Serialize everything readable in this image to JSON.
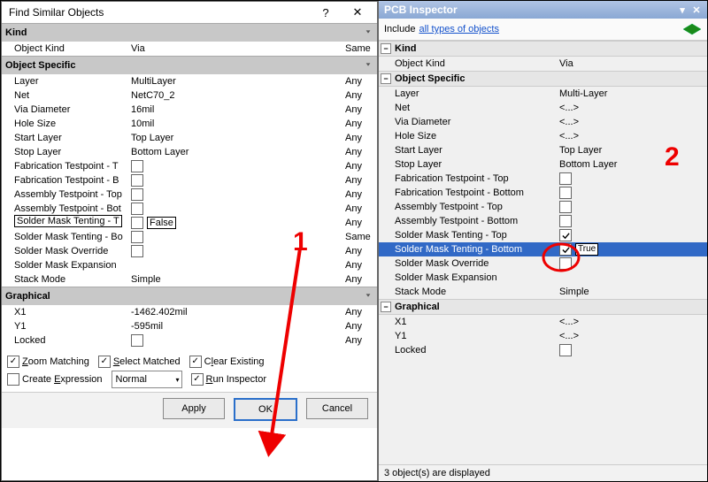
{
  "dialog": {
    "title": "Find Similar Objects",
    "kind_hdr": "Kind",
    "object_kind_label": "Object Kind",
    "object_kind_val": "Via",
    "object_kind_match": "Same",
    "objspec_hdr": "Object Specific",
    "rows": [
      {
        "name": "Layer",
        "val": "MultiLayer",
        "match": "Any"
      },
      {
        "name": "Net",
        "val": "NetC70_2",
        "match": "Any"
      },
      {
        "name": "Via Diameter",
        "val": "16mil",
        "match": "Any"
      },
      {
        "name": "Hole Size",
        "val": "10mil",
        "match": "Any"
      },
      {
        "name": "Start Layer",
        "val": "Top Layer",
        "match": "Any"
      },
      {
        "name": "Stop Layer",
        "val": "Bottom Layer",
        "match": "Any"
      }
    ],
    "bool_rows": [
      {
        "name": "Fabrication Testpoint - T",
        "match": "Any"
      },
      {
        "name": "Fabrication Testpoint - B",
        "match": "Any"
      },
      {
        "name": "Assembly Testpoint - Top",
        "match": "Any"
      },
      {
        "name": "Assembly Testpoint - Bot",
        "match": "Any"
      }
    ],
    "sm_top_name": "Solder Mask Tenting - T",
    "sm_top_val": "False",
    "sm_top_match": "Any",
    "more_rows": [
      {
        "name": "Solder Mask Tenting - Bo",
        "match": "Same"
      },
      {
        "name": "Solder Mask Override",
        "match": "Any"
      },
      {
        "name": "Solder Mask Expansion",
        "match": "Any"
      }
    ],
    "stack_mode_name": "Stack Mode",
    "stack_mode_val": "Simple",
    "stack_mode_match": "Any",
    "graphical_hdr": "Graphical",
    "gx_name": "X1",
    "gx_val": "-1462.402mil",
    "gx_match": "Any",
    "gy_name": "Y1",
    "gy_val": "-595mil",
    "gy_match": "Any",
    "glocked_name": "Locked",
    "glocked_match": "Any",
    "opt_zoom": "Zoom Matching",
    "opt_selmatch": "Select Matched",
    "opt_clear": "Clear Existing",
    "opt_create": "Create Expression",
    "combo_val": "Normal",
    "opt_run": "Run Inspector",
    "btn_apply": "Apply",
    "btn_ok": "OK",
    "btn_cancel": "Cancel"
  },
  "panel": {
    "title": "PCB Inspector",
    "include_label": "Include",
    "include_link": "all types of objects",
    "kind_hdr": "Kind",
    "objkind_label": "Object Kind",
    "objkind_val": "Via",
    "objspec_hdr": "Object Specific",
    "rows": [
      {
        "k": "Layer",
        "v": "Multi-Layer"
      },
      {
        "k": "Net",
        "v": "<...>",
        "link": true
      },
      {
        "k": "Via Diameter",
        "v": "<...>"
      },
      {
        "k": "Hole Size",
        "v": "<...>"
      },
      {
        "k": "Start Layer",
        "v": "Top Layer"
      },
      {
        "k": "Stop Layer",
        "v": "Bottom Layer"
      }
    ],
    "bool_rows": [
      {
        "k": "Fabrication Testpoint - Top",
        "checked": false
      },
      {
        "k": "Fabrication Testpoint - Bottom",
        "checked": false
      },
      {
        "k": "Assembly Testpoint - Top",
        "checked": false
      },
      {
        "k": "Assembly Testpoint - Bottom",
        "checked": false
      },
      {
        "k": "Solder Mask Tenting - Top",
        "checked": true
      }
    ],
    "sel_row_k": "Solder Mask Tenting - Bottom",
    "sel_row_v": "True",
    "sel_row_checked": true,
    "more_rows": [
      {
        "k": "Solder Mask Override",
        "checked": false
      },
      {
        "k": "Solder Mask Expansion",
        "v": ""
      },
      {
        "k": "Stack Mode",
        "v": "Simple"
      }
    ],
    "graphical_hdr": "Graphical",
    "gx_k": "X1",
    "gx_v": "<...>",
    "gy_k": "Y1",
    "gy_v": "<...>",
    "glocked_k": "Locked",
    "status": "3 object(s) are displayed"
  },
  "anno": {
    "1": "1",
    "2": "2"
  }
}
